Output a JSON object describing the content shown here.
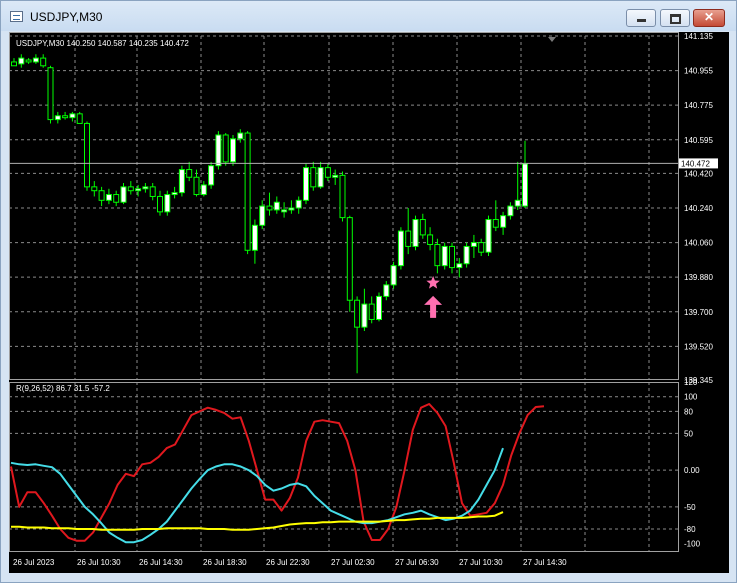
{
  "window": {
    "title": "USDJPY,M30",
    "minimize_icon": "minimize-icon",
    "maximize_icon": "maximize-icon",
    "close_icon": "close-icon"
  },
  "colors": {
    "background": "#000000",
    "grid": "#8a8a8a",
    "bull_candle": "#ffffff",
    "bear_candle": "#000000",
    "candle_outline": "#00ff00",
    "indicator_red": "#e0181e",
    "indicator_cyan": "#45dde8",
    "indicator_yellow": "#ffff00",
    "marker_pink": "#ff6fb0"
  },
  "main_chart": {
    "info": "USDJPY,M30  140.250 140.587 140.235 140.472",
    "current_price": "140.472",
    "price_labels": [
      "141.135",
      "140.955",
      "140.775",
      "140.595",
      "140.420",
      "140.240",
      "140.060",
      "139.880",
      "139.700",
      "139.520",
      "139.345"
    ],
    "markers": [
      {
        "type": "star-icon",
        "price": 139.85,
        "bar": 57
      },
      {
        "type": "up-arrow-icon",
        "price": 139.72,
        "bar": 57
      }
    ]
  },
  "indicator": {
    "info": "R(9,26,52) 86.7 31.5 -57.2",
    "labels": [
      "120",
      "100",
      "80",
      "50",
      "0.00",
      "-50",
      "-80",
      "-100"
    ]
  },
  "time_axis": {
    "labels": [
      "26 Jul 2023",
      "26 Jul 10:30",
      "26 Jul 14:30",
      "26 Jul 18:30",
      "26 Jul 22:30",
      "27 Jul 02:30",
      "27 Jul 06:30",
      "27 Jul 10:30",
      "27 Jul 14:30"
    ]
  },
  "chart_data": {
    "type": "candlestick",
    "symbol": "USDJPY",
    "timeframe": "M30",
    "ylim": [
      139.345,
      141.135
    ],
    "candles": [
      {
        "o": 141.0,
        "h": 141.02,
        "l": 140.98,
        "c": 140.98
      },
      {
        "o": 140.99,
        "h": 141.04,
        "l": 140.97,
        "c": 141.02
      },
      {
        "o": 141.01,
        "h": 141.02,
        "l": 140.99,
        "c": 141.0
      },
      {
        "o": 141.0,
        "h": 141.04,
        "l": 140.99,
        "c": 141.02
      },
      {
        "o": 141.02,
        "h": 141.04,
        "l": 140.97,
        "c": 140.98
      },
      {
        "o": 140.97,
        "h": 140.98,
        "l": 140.68,
        "c": 140.7
      },
      {
        "o": 140.7,
        "h": 140.74,
        "l": 140.68,
        "c": 140.72
      },
      {
        "o": 140.72,
        "h": 140.74,
        "l": 140.7,
        "c": 140.71
      },
      {
        "o": 140.71,
        "h": 140.74,
        "l": 140.69,
        "c": 140.73
      },
      {
        "o": 140.73,
        "h": 140.74,
        "l": 140.68,
        "c": 140.68
      },
      {
        "o": 140.68,
        "h": 140.69,
        "l": 140.33,
        "c": 140.35
      },
      {
        "o": 140.35,
        "h": 140.38,
        "l": 140.3,
        "c": 140.33
      },
      {
        "o": 140.33,
        "h": 140.35,
        "l": 140.25,
        "c": 140.28
      },
      {
        "o": 140.28,
        "h": 140.34,
        "l": 140.26,
        "c": 140.31
      },
      {
        "o": 140.31,
        "h": 140.33,
        "l": 140.25,
        "c": 140.27
      },
      {
        "o": 140.27,
        "h": 140.37,
        "l": 140.26,
        "c": 140.35
      },
      {
        "o": 140.35,
        "h": 140.38,
        "l": 140.31,
        "c": 140.33
      },
      {
        "o": 140.33,
        "h": 140.36,
        "l": 140.3,
        "c": 140.34
      },
      {
        "o": 140.34,
        "h": 140.37,
        "l": 140.32,
        "c": 140.35
      },
      {
        "o": 140.35,
        "h": 140.37,
        "l": 140.28,
        "c": 140.3
      },
      {
        "o": 140.3,
        "h": 140.33,
        "l": 140.2,
        "c": 140.22
      },
      {
        "o": 140.22,
        "h": 140.33,
        "l": 140.2,
        "c": 140.31
      },
      {
        "o": 140.31,
        "h": 140.35,
        "l": 140.29,
        "c": 140.32
      },
      {
        "o": 140.32,
        "h": 140.46,
        "l": 140.3,
        "c": 140.44
      },
      {
        "o": 140.44,
        "h": 140.48,
        "l": 140.38,
        "c": 140.4
      },
      {
        "o": 140.4,
        "h": 140.44,
        "l": 140.3,
        "c": 140.31
      },
      {
        "o": 140.31,
        "h": 140.38,
        "l": 140.3,
        "c": 140.36
      },
      {
        "o": 140.36,
        "h": 140.48,
        "l": 140.34,
        "c": 140.46
      },
      {
        "o": 140.46,
        "h": 140.64,
        "l": 140.44,
        "c": 140.62
      },
      {
        "o": 140.62,
        "h": 140.63,
        "l": 140.46,
        "c": 140.48
      },
      {
        "o": 140.48,
        "h": 140.62,
        "l": 140.46,
        "c": 140.6
      },
      {
        "o": 140.6,
        "h": 140.65,
        "l": 140.58,
        "c": 140.63
      },
      {
        "o": 140.63,
        "h": 140.64,
        "l": 140.0,
        "c": 140.02
      },
      {
        "o": 140.02,
        "h": 140.18,
        "l": 139.95,
        "c": 140.15
      },
      {
        "o": 140.15,
        "h": 140.28,
        "l": 140.13,
        "c": 140.25
      },
      {
        "o": 140.25,
        "h": 140.32,
        "l": 140.2,
        "c": 140.23
      },
      {
        "o": 140.23,
        "h": 140.3,
        "l": 140.21,
        "c": 140.27
      },
      {
        "o": 140.22,
        "h": 140.27,
        "l": 140.19,
        "c": 140.23
      },
      {
        "o": 140.23,
        "h": 140.28,
        "l": 140.21,
        "c": 140.24
      },
      {
        "o": 140.24,
        "h": 140.3,
        "l": 140.21,
        "c": 140.28
      },
      {
        "o": 140.28,
        "h": 140.47,
        "l": 140.26,
        "c": 140.45
      },
      {
        "o": 140.45,
        "h": 140.48,
        "l": 140.33,
        "c": 140.35
      },
      {
        "o": 140.35,
        "h": 140.48,
        "l": 140.34,
        "c": 140.45
      },
      {
        "o": 140.45,
        "h": 140.47,
        "l": 140.38,
        "c": 140.4
      },
      {
        "o": 140.4,
        "h": 140.44,
        "l": 140.36,
        "c": 140.41
      },
      {
        "o": 140.41,
        "h": 140.43,
        "l": 140.17,
        "c": 140.19
      },
      {
        "o": 140.19,
        "h": 140.2,
        "l": 139.7,
        "c": 139.76
      },
      {
        "o": 139.76,
        "h": 139.78,
        "l": 139.38,
        "c": 139.62
      },
      {
        "o": 139.62,
        "h": 139.82,
        "l": 139.6,
        "c": 139.74
      },
      {
        "o": 139.74,
        "h": 139.78,
        "l": 139.64,
        "c": 139.66
      },
      {
        "o": 139.66,
        "h": 139.8,
        "l": 139.65,
        "c": 139.78
      },
      {
        "o": 139.78,
        "h": 139.86,
        "l": 139.76,
        "c": 139.84
      },
      {
        "o": 139.84,
        "h": 139.96,
        "l": 139.82,
        "c": 139.94
      },
      {
        "o": 139.94,
        "h": 140.14,
        "l": 139.92,
        "c": 140.12
      },
      {
        "o": 140.12,
        "h": 140.24,
        "l": 140.0,
        "c": 140.04
      },
      {
        "o": 140.04,
        "h": 140.2,
        "l": 140.02,
        "c": 140.18
      },
      {
        "o": 140.18,
        "h": 140.21,
        "l": 140.08,
        "c": 140.1
      },
      {
        "o": 140.1,
        "h": 140.14,
        "l": 140.02,
        "c": 140.05
      },
      {
        "o": 140.05,
        "h": 140.08,
        "l": 139.9,
        "c": 139.94
      },
      {
        "o": 139.94,
        "h": 140.06,
        "l": 139.92,
        "c": 140.04
      },
      {
        "o": 140.04,
        "h": 140.06,
        "l": 139.9,
        "c": 139.93
      },
      {
        "o": 139.93,
        "h": 139.98,
        "l": 139.88,
        "c": 139.95
      },
      {
        "o": 139.95,
        "h": 140.06,
        "l": 139.93,
        "c": 140.04
      },
      {
        "o": 140.04,
        "h": 140.1,
        "l": 139.98,
        "c": 140.06
      },
      {
        "o": 140.06,
        "h": 140.08,
        "l": 139.99,
        "c": 140.01
      },
      {
        "o": 140.01,
        "h": 140.2,
        "l": 139.99,
        "c": 140.18
      },
      {
        "o": 140.18,
        "h": 140.28,
        "l": 140.12,
        "c": 140.14
      },
      {
        "o": 140.14,
        "h": 140.22,
        "l": 140.1,
        "c": 140.2
      },
      {
        "o": 140.2,
        "h": 140.27,
        "l": 140.18,
        "c": 140.25
      },
      {
        "o": 140.25,
        "h": 140.48,
        "l": 140.23,
        "c": 140.28
      },
      {
        "o": 140.25,
        "h": 140.59,
        "l": 140.24,
        "c": 140.47
      }
    ],
    "indicator_series": [
      {
        "name": "",
        "color": "#e0181e",
        "values": [
          5,
          -50,
          -30,
          -30,
          -45,
          -62,
          -80,
          -92,
          -96,
          -96,
          -85,
          -65,
          -45,
          -20,
          -5,
          -8,
          8,
          10,
          18,
          30,
          35,
          55,
          75,
          80,
          85,
          82,
          78,
          70,
          72,
          40,
          0,
          -40,
          -40,
          -55,
          -38,
          -10,
          40,
          66,
          68,
          66,
          64,
          40,
          0,
          -70,
          -95,
          -95,
          -80,
          -50,
          0,
          55,
          85,
          90,
          78,
          60,
          10,
          -45,
          -62,
          -60,
          -58,
          -45,
          -20,
          20,
          50,
          75,
          86,
          87
        ]
      },
      {
        "name": "",
        "color": "#45dde8",
        "values": [
          10,
          8,
          7,
          8,
          6,
          4,
          -5,
          -20,
          -35,
          -50,
          -60,
          -72,
          -85,
          -92,
          -98,
          -98,
          -95,
          -88,
          -80,
          -70,
          -55,
          -40,
          -25,
          -12,
          0,
          5,
          8,
          8,
          5,
          0,
          -8,
          -20,
          -28,
          -25,
          -20,
          -18,
          -22,
          -35,
          -45,
          -55,
          -60,
          -65,
          -70,
          -72,
          -72,
          -70,
          -68,
          -64,
          -60,
          -58,
          -55,
          -60,
          -64,
          -68,
          -66,
          -62,
          -55,
          -40,
          -20,
          0,
          30
        ]
      },
      {
        "name": "",
        "color": "#ffff00",
        "values": [
          -77,
          -77,
          -78,
          -78,
          -78,
          -79,
          -79,
          -79,
          -80,
          -80,
          -80,
          -81,
          -81,
          -81,
          -81,
          -81,
          -80,
          -80,
          -80,
          -79,
          -79,
          -79,
          -79,
          -79,
          -80,
          -80,
          -80,
          -81,
          -81,
          -81,
          -80,
          -79,
          -78,
          -76,
          -74,
          -73,
          -72,
          -72,
          -71,
          -71,
          -70,
          -70,
          -70,
          -70,
          -70,
          -70,
          -69,
          -68,
          -68,
          -67,
          -66,
          -66,
          -65,
          -65,
          -65,
          -65,
          -64,
          -63,
          -63,
          -62,
          -57
        ]
      }
    ],
    "indicator_ylim": [
      -110,
      120
    ]
  }
}
